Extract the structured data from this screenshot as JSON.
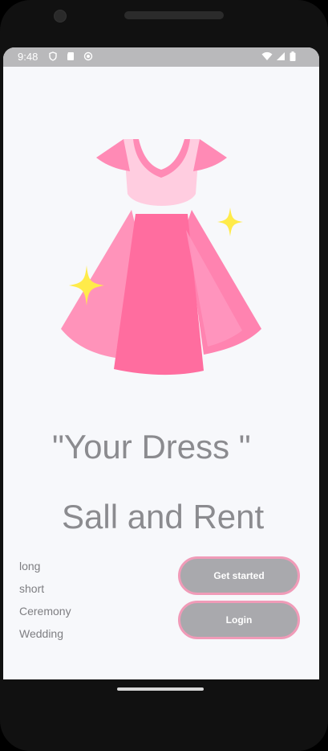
{
  "status_bar": {
    "time": "9:48",
    "left_icons": [
      "shield-icon",
      "sd-card-icon",
      "record-icon"
    ],
    "right_icons": [
      "wifi-icon",
      "signal-icon",
      "battery-icon"
    ]
  },
  "hero": {
    "image": "pink-dress-illustration",
    "colors": {
      "dress_pink": "#ff78a8",
      "dress_light": "#ffcde0",
      "sparkle": "#ffeb4a"
    }
  },
  "headline": {
    "line1": "\"Your Dress \"",
    "line2": "Sall and Rent"
  },
  "categories": [
    "long",
    "short",
    "Ceremony",
    "Wedding"
  ],
  "buttons": {
    "get_started": "Get started",
    "login": "Login"
  },
  "theme": {
    "button_bg": "#a9a9ad",
    "button_border": "#f09bb8",
    "text_gray": "#8b8b8f"
  }
}
